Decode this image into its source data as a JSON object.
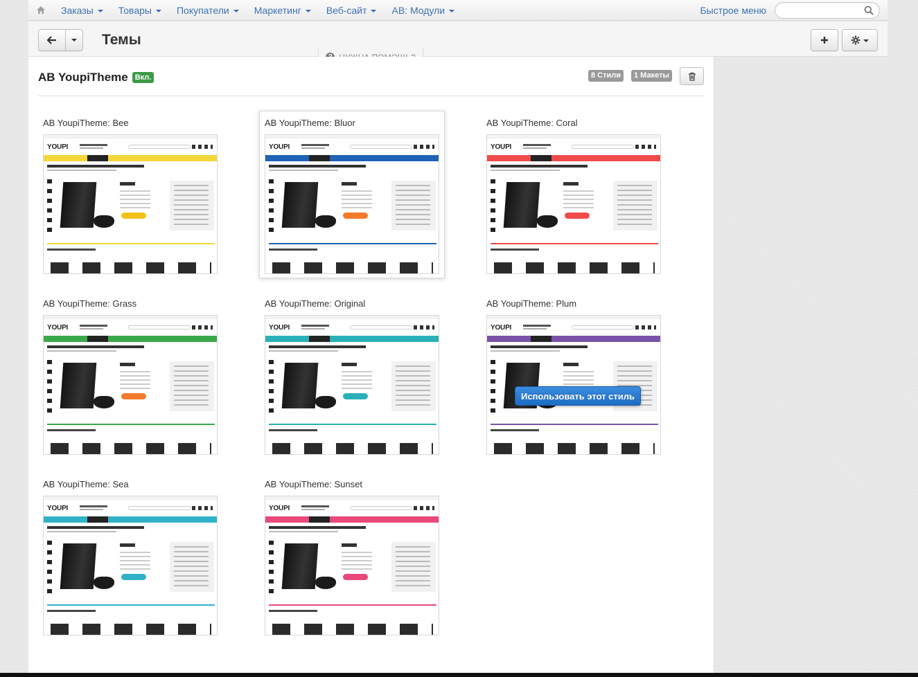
{
  "nav": {
    "items": [
      {
        "label": "Заказы"
      },
      {
        "label": "Товары"
      },
      {
        "label": "Покупатели"
      },
      {
        "label": "Маркетинг"
      },
      {
        "label": "Веб-сайт"
      },
      {
        "label": "AB: Модули"
      }
    ],
    "quick_menu": "Быстрое меню",
    "search_placeholder": ""
  },
  "header": {
    "title": "Темы",
    "help": "НУЖНА ПОМОЩЬ?"
  },
  "theme": {
    "name": "AB YoupiTheme",
    "status": "Вкл.",
    "styles_badge": "8 Стили",
    "layouts_badge": "1 Макеты"
  },
  "preview": {
    "logo": "YOUPI",
    "use_style_button": "Использовать этот стиль"
  },
  "styles": [
    {
      "name": "AB YoupiTheme: Bee",
      "accent": "#f5d73a",
      "buy": "#f2c21b"
    },
    {
      "name": "AB YoupiTheme: Bluor",
      "accent": "#1e63b6",
      "buy": "#f47a2b"
    },
    {
      "name": "AB YoupiTheme: Coral",
      "accent": "#f04b4b",
      "buy": "#f04b4b"
    },
    {
      "name": "AB YoupiTheme: Grass",
      "accent": "#3aa84a",
      "buy": "#f47a2b"
    },
    {
      "name": "AB YoupiTheme: Original",
      "accent": "#2bb0b8",
      "buy": "#2bb0b8"
    },
    {
      "name": "AB YoupiTheme: Plum",
      "accent": "#7a52a8",
      "buy": "#7a52a8"
    },
    {
      "name": "AB YoupiTheme: Sea",
      "accent": "#2fb2c7",
      "buy": "#2fb2c7"
    },
    {
      "name": "AB YoupiTheme: Sunset",
      "accent": "#e8487a",
      "buy": "#e8487a"
    }
  ]
}
